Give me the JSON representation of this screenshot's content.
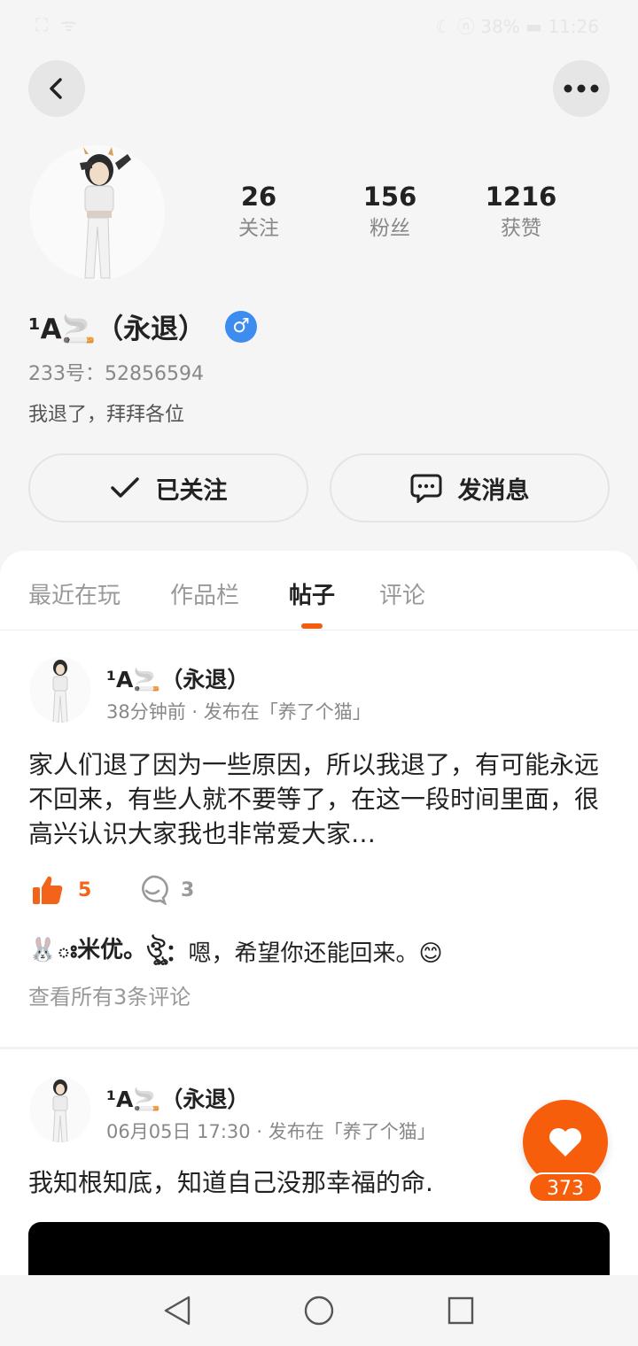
{
  "status_bar": {
    "left": "⛶ ᯤ",
    "right": "☾ ⓝ 38% ▬ 11:26"
  },
  "header": {
    "back_icon": "back-arrow-icon",
    "more_icon": "more-dots-icon"
  },
  "profile": {
    "stats": [
      {
        "num": "26",
        "label": "关注"
      },
      {
        "num": "156",
        "label": "粉丝"
      },
      {
        "num": "1216",
        "label": "获赞"
      }
    ],
    "username": "¹A🚬（永退）",
    "gender_symbol": "♂",
    "uid": "233号：52856594",
    "bio": "我退了，拜拜各位",
    "follow_label": "已关注",
    "message_label": "发消息"
  },
  "tabs": [
    "最近在玩",
    "作品栏",
    "帖子",
    "评论"
  ],
  "active_tab": 2,
  "posts": [
    {
      "author": "¹A🚬（永退）",
      "time": "38分钟前",
      "meta_sep": "·",
      "location": "发布在「养了个猫」",
      "text": "家人们退了因为一些原因，所以我退了，有可能永远不回来，有些人就不要等了，在这一段时间里面，很高兴认识大家我也非常爱大家…",
      "likes": "5",
      "comments": "3",
      "comment_author": "🐰ః米优。ঔৣ",
      "comment_colon": "：",
      "comment_text": "嗯，希望你还能回来。😊",
      "view_all": "查看所有3条评论"
    },
    {
      "author": "¹A🚬（永退）",
      "time": "06月05日 17:30",
      "meta_sep": "·",
      "location": "发布在「养了个猫」",
      "text": "我知根知底，知道自己没那幸福的命."
    }
  ],
  "fab": {
    "count": "373",
    "icon": "heart-icon"
  },
  "colors": {
    "accent": "#f25d0e",
    "gender_blue": "#3d8cf0"
  }
}
